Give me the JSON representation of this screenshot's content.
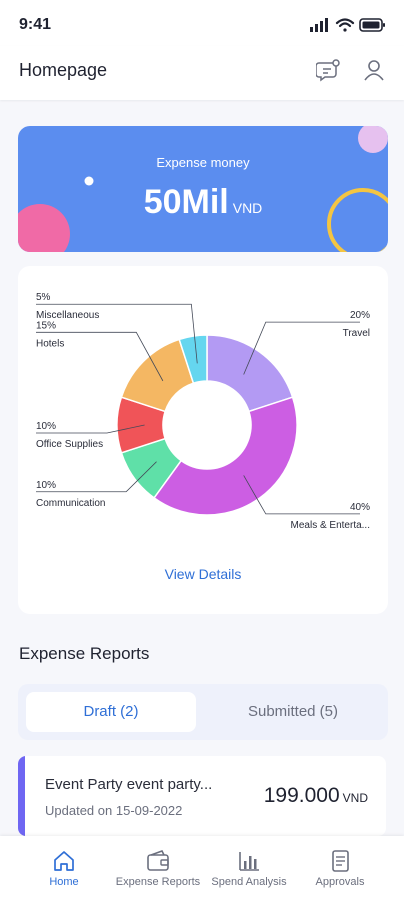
{
  "status_bar": {
    "time": "9:41"
  },
  "header": {
    "title": "Homepage",
    "icons": [
      "chat-bubble-icon",
      "user-icon"
    ]
  },
  "expense_card": {
    "label": "Expense money",
    "amount": "50Mil",
    "currency": "VND",
    "colors": {
      "background": "#5b8def"
    }
  },
  "chart_data": {
    "type": "pie",
    "donut": true,
    "categories": [
      "Travel",
      "Meals & Enterta...",
      "Communication",
      "Office Supplies",
      "Hotels",
      "Miscellaneous"
    ],
    "values": [
      20,
      40,
      10,
      10,
      15,
      5
    ],
    "value_labels": [
      "20%",
      "40%",
      "10%",
      "10%",
      "15%",
      "5%"
    ],
    "colors": [
      "#b39af3",
      "#cc5ee3",
      "#5fe0a8",
      "#f05458",
      "#f4b763",
      "#65d6ef"
    ]
  },
  "chart_card": {
    "view_details": "View Details"
  },
  "expense_reports": {
    "title": "Expense Reports",
    "tabs": [
      {
        "label": "Draft (2)",
        "active": true
      },
      {
        "label": "Submitted (5)",
        "active": false
      }
    ],
    "items": [
      {
        "title": "Event Party event party...",
        "updated_label": "Updated on",
        "updated_date": "15-09-2022",
        "amount": "199.000",
        "currency": "VND"
      }
    ]
  },
  "bottom_nav": {
    "items": [
      {
        "label": "Home",
        "icon": "home-icon",
        "active": true
      },
      {
        "label": "Expense Reports",
        "icon": "wallet-icon",
        "active": false
      },
      {
        "label": "Spend Analysis",
        "icon": "bar-chart-icon",
        "active": false
      },
      {
        "label": "Approvals",
        "icon": "document-icon",
        "active": false
      }
    ]
  },
  "colors": {
    "accent": "#2f6fd6",
    "report_accent": "#6f66f2"
  }
}
